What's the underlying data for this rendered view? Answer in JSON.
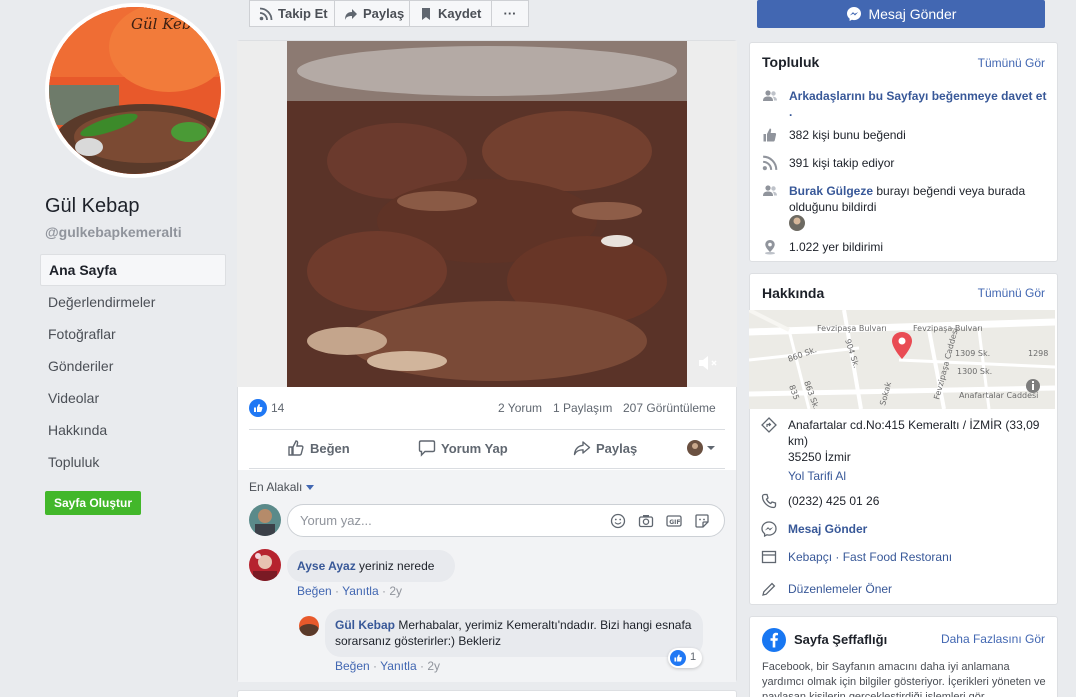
{
  "page": {
    "name": "Gül Kebap",
    "handle": "@gulkebapkemeralti"
  },
  "nav": [
    {
      "label": "Ana Sayfa"
    },
    {
      "label": "Değerlendirmeler"
    },
    {
      "label": "Fotoğraflar"
    },
    {
      "label": "Gönderiler"
    },
    {
      "label": "Videolar"
    },
    {
      "label": "Hakkında"
    },
    {
      "label": "Topluluk"
    }
  ],
  "create_page": "Sayfa Oluştur",
  "toolbar": {
    "follow": "Takip Et",
    "share": "Paylaş",
    "save": "Kaydet",
    "more": "···",
    "message": "Mesaj Gönder"
  },
  "post": {
    "reactions": "14",
    "comments": "2 Yorum",
    "shares": "1 Paylaşım",
    "views": "207 Görüntüleme",
    "like": "Beğen",
    "comment": "Yorum Yap",
    "share": "Paylaş",
    "sort": "En Alakalı",
    "input_placeholder": "Yorum yaz...",
    "comments_list": [
      {
        "author": "Ayse Ayaz",
        "text": "yeriniz nerede",
        "like": "Beğen",
        "reply": "Yanıtla",
        "time": "2y"
      },
      {
        "author": "Gül Kebap",
        "text": "Merhabalar, yerimiz Kemeraltı'ndadır. Bizi hangi esnafa sorarsanız gösterirler:) Bekleriz",
        "like": "Beğen",
        "reply": "Yanıtla",
        "time": "2y",
        "reaction_count": "1"
      }
    ]
  },
  "community": {
    "title": "Topluluk",
    "see_all": "Tümünü Gör",
    "invite": "Arkadaşlarını bu Sayfayı beğenmeye davet et .",
    "likes": "382 kişi bunu beğendi",
    "follows": "391 kişi takip ediyor",
    "friend_name": "Burak Gülgeze",
    "friend_text": "burayı beğendi veya burada olduğunu bildirdi",
    "checkins": "1.022 yer bildirimi"
  },
  "about": {
    "title": "Hakkında",
    "see_all": "Tümünü Gör",
    "address": "Anafartalar cd.No:415 Kemeraltı / İZMİR (33,09 km)",
    "city": "35250 İzmir",
    "directions": "Yol Tarifi Al",
    "phone": "(0232) 425 01 26",
    "message": "Mesaj Gönder",
    "categories": "Kebapçı · Fast Food Restoranı",
    "suggest": "Düzenlemeler Öner",
    "map_labels": {
      "street1": "Fevzipaşa Bulvarı",
      "street2": "Fevzipaşa Bulvarı",
      "street3": "860 Sk.",
      "street4": "904 Sk.",
      "street5": "1309 Sk.",
      "street6": "1298",
      "street7": "1300 Sk.",
      "street8": "Anafartalar Caddesi",
      "street9": "863 Sk.",
      "street10": "Fevzipaşa Caddesi",
      "street11": "835",
      "street12": "Sokak"
    }
  },
  "transparency": {
    "title": "Sayfa Şeffaflığı",
    "more": "Daha Fazlasını Gör",
    "text": "Facebook, bir Sayfanın amacını daha iyi anlamana yardımcı olmak için bilgiler gösteriyor. İçerikleri yöneten ve paylaşan kişilerin gerçekleştirdiği işlemleri gör."
  },
  "colors": {
    "brand": "#4267b2",
    "link": "#385898",
    "create": "#42b72a",
    "map_pin": "#e94b53"
  }
}
